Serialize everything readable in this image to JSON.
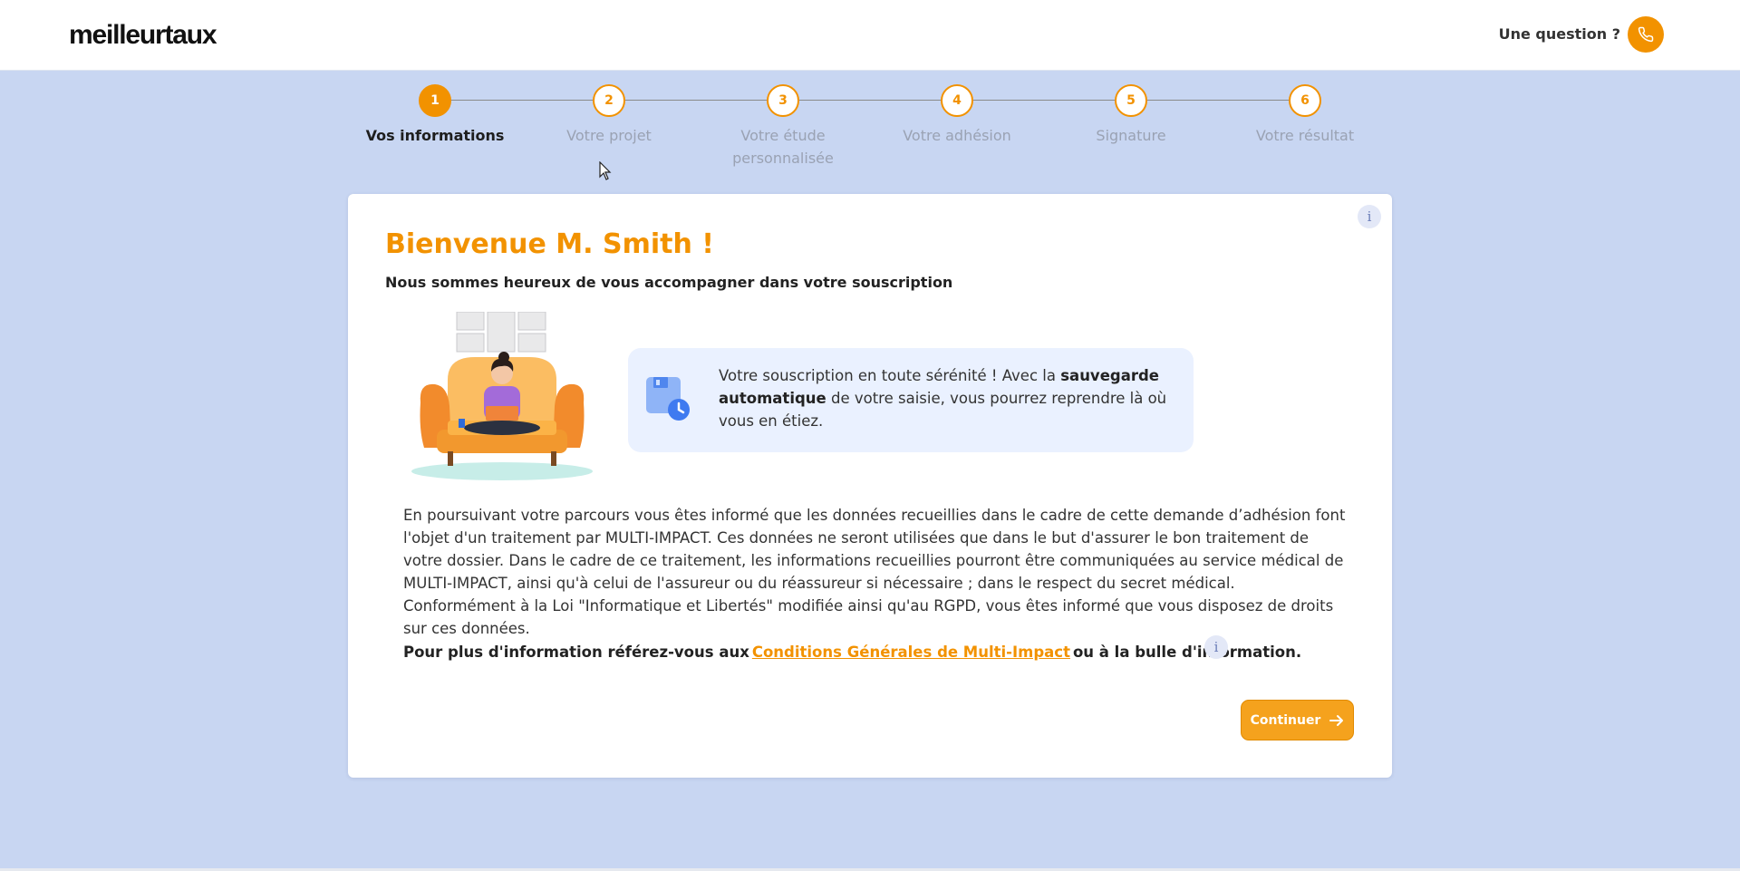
{
  "header": {
    "logo": "meilleurtaux",
    "question_label": "Une question ?",
    "phone_icon": "phone-icon"
  },
  "stepper": {
    "steps": [
      {
        "number": "1",
        "label": "Vos informations",
        "active": true
      },
      {
        "number": "2",
        "label": "Votre projet",
        "active": false
      },
      {
        "number": "3",
        "label": "Votre étude personnalisée",
        "active": false
      },
      {
        "number": "4",
        "label": "Votre adhésion",
        "active": false
      },
      {
        "number": "5",
        "label": "Signature",
        "active": false
      },
      {
        "number": "6",
        "label": "Votre résultat",
        "active": false
      }
    ]
  },
  "card": {
    "info_icon": "i",
    "welcome": "Bienvenue M. Smith !",
    "subtitle": "Nous sommes heureux de vous accompagner dans votre souscription",
    "autosave": {
      "part1": "Votre souscription en toute sérénité ! Avec la ",
      "bold": "sauvegarde automatique",
      "part2": " de votre saisie, vous pourrez reprendre là où vous en étiez."
    },
    "legal_text": "En poursuivant votre parcours vous êtes informé que les données recueillies dans le cadre de cette demande d’adhésion font l'objet d'un traitement par MULTI-IMPACT. Ces données ne seront utilisées que dans le but d'assurer le bon traitement de votre dossier. Dans le cadre de ce traitement, les informations recueillies pourront être communiquées au service médical de MULTI-IMPACT, ainsi qu'à celui de l'assureur ou du réassureur si nécessaire ; dans le respect du secret médical. Conformément à la Loi \"Informatique et Libertés\" modifiée ainsi qu'au RGPD, vous êtes informé que vous disposez de droits sur ces données.",
    "more_info_prefix": "Pour plus d'information référez-vous aux",
    "more_info_link": "Conditions Générales de Multi-Impact",
    "more_info_suffix": "ou à la bulle d'information.",
    "continue_label": "Continuer"
  },
  "colors": {
    "accent": "#f29200",
    "background": "#c8d6f2",
    "autosave_bg": "#eaf1ff"
  }
}
